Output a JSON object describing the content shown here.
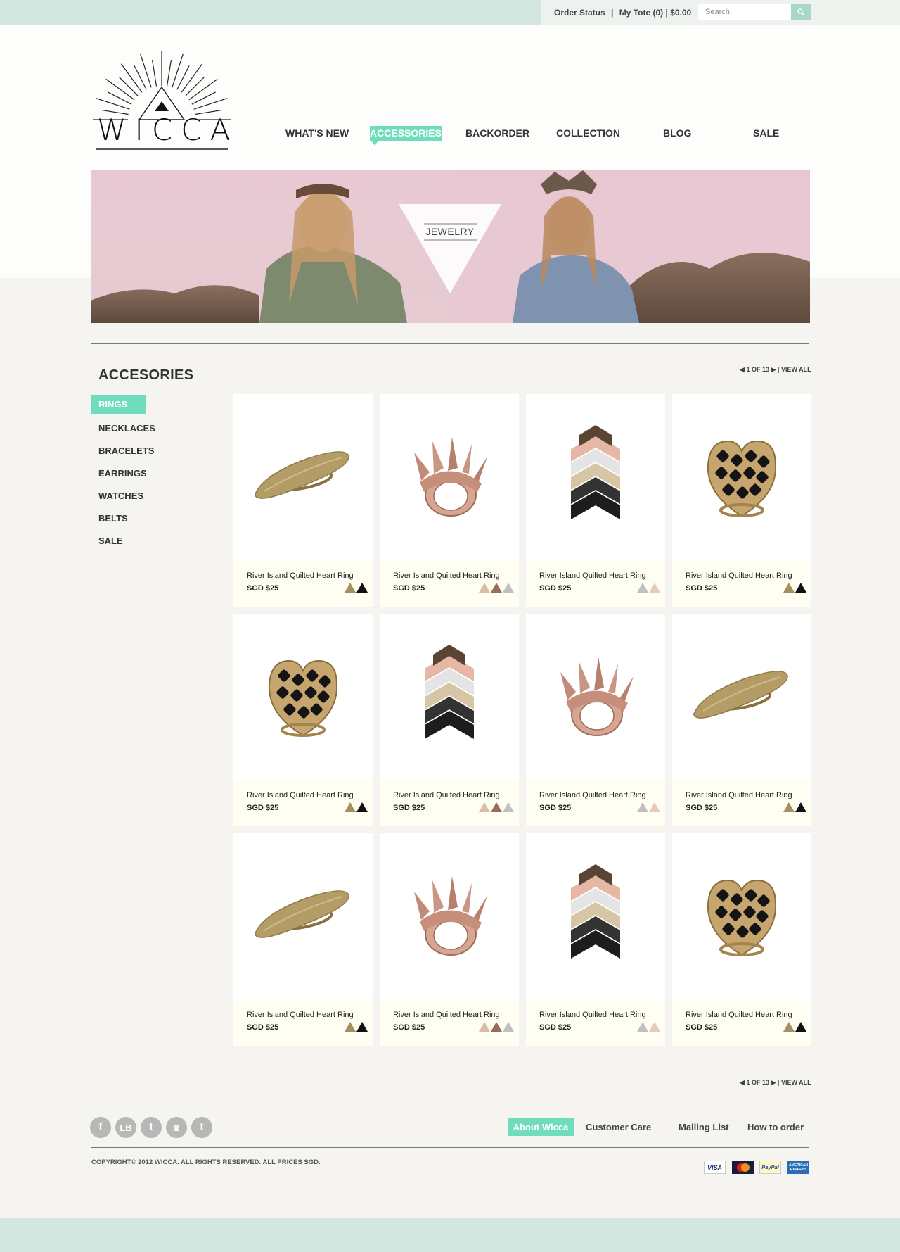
{
  "topbar": {
    "order_status": "Order Status",
    "separator": "|",
    "tote": "My Tote (0) | $0.00",
    "search_placeholder": "Search"
  },
  "logo": {
    "text": "WICCA"
  },
  "nav": {
    "whats_new": "WHAT'S NEW",
    "accessories": "ACCESSORIES",
    "backorder": "BACKORDER",
    "collection": "COLLECTION",
    "blog": "BLOG",
    "sale": "SALE"
  },
  "banner": {
    "label": "JEWELRY"
  },
  "section": {
    "title": "ACCESORIES"
  },
  "pager": {
    "text": "1 OF 13",
    "separator": "|",
    "view_all": "VIEW ALL"
  },
  "categories": {
    "rings": "RINGS",
    "necklaces": "NECKLACES",
    "bracelets": "BRACELETS",
    "earrings": "EARRINGS",
    "watches": "WATCHES",
    "belts": "BELTS",
    "sale": "SALE"
  },
  "colors": {
    "accent": "#6fdcbb",
    "topbar": "#d3e6df",
    "gold": "#a58f62",
    "black": "#111111",
    "rose": "#9a6a5a",
    "nude": "#d9bfa2",
    "silver": "#c0c0c0",
    "blush": "#e8cabb"
  },
  "products": [
    {
      "name": "River Island Quilted Heart Ring",
      "price": "SGD $25",
      "image": "gold-plate-ring",
      "swatches": [
        "#a58f62",
        "#111111"
      ]
    },
    {
      "name": "River Island Quilted Heart Ring",
      "price": "SGD $25",
      "image": "spike-ring",
      "swatches": [
        "#d9bfa2",
        "#9a6a5a",
        "#c0c0c0"
      ]
    },
    {
      "name": "River Island Quilted Heart Ring",
      "price": "SGD $25",
      "image": "chevron-stack-ring",
      "swatches": [
        "#c0c0c0",
        "#e8cabb"
      ]
    },
    {
      "name": "River Island Quilted Heart Ring",
      "price": "SGD $25",
      "image": "quilted-heart-ring",
      "swatches": [
        "#a58f62",
        "#111111"
      ]
    },
    {
      "name": "River Island Quilted Heart Ring",
      "price": "SGD $25",
      "image": "quilted-heart-ring",
      "swatches": [
        "#a58f62",
        "#111111"
      ]
    },
    {
      "name": "River Island Quilted Heart Ring",
      "price": "SGD $25",
      "image": "chevron-stack-ring",
      "swatches": [
        "#d9bfa2",
        "#9a6a5a",
        "#c0c0c0"
      ]
    },
    {
      "name": "River Island Quilted Heart Ring",
      "price": "SGD $25",
      "image": "spike-ring",
      "swatches": [
        "#c0c0c0",
        "#e8cabb"
      ]
    },
    {
      "name": "River Island Quilted Heart Ring",
      "price": "SGD $25",
      "image": "gold-plate-ring",
      "swatches": [
        "#a58f62",
        "#111111"
      ]
    },
    {
      "name": "River Island Quilted Heart Ring",
      "price": "SGD $25",
      "image": "gold-plate-ring",
      "swatches": [
        "#a58f62",
        "#111111"
      ]
    },
    {
      "name": "River Island Quilted Heart Ring",
      "price": "SGD $25",
      "image": "spike-ring",
      "swatches": [
        "#d9bfa2",
        "#9a6a5a",
        "#c0c0c0"
      ]
    },
    {
      "name": "River Island Quilted Heart Ring",
      "price": "SGD $25",
      "image": "chevron-stack-ring",
      "swatches": [
        "#c0c0c0",
        "#e8cabb"
      ]
    },
    {
      "name": "River Island Quilted Heart Ring",
      "price": "SGD $25",
      "image": "quilted-heart-ring",
      "swatches": [
        "#a58f62",
        "#111111"
      ]
    }
  ],
  "social": [
    {
      "icon": "facebook-icon",
      "glyph": "f"
    },
    {
      "icon": "lookbook-icon",
      "glyph": "LB"
    },
    {
      "icon": "tumblr-icon",
      "glyph": "t"
    },
    {
      "icon": "instagram-icon",
      "glyph": "◙"
    },
    {
      "icon": "twitter-icon",
      "glyph": "t"
    }
  ],
  "footer": {
    "about": "About Wicca",
    "customer_care": "Customer Care",
    "mailing_list": "Mailing List",
    "how_to_order": "How to order",
    "copyright": "COPYRIGHT© 2012 WICCA. ALL RIGHTS RESERVED. ALL PRICES SGD.",
    "payments": [
      "VISA",
      "MasterCard",
      "PayPal",
      "AMERICAN EXPRESS"
    ]
  }
}
